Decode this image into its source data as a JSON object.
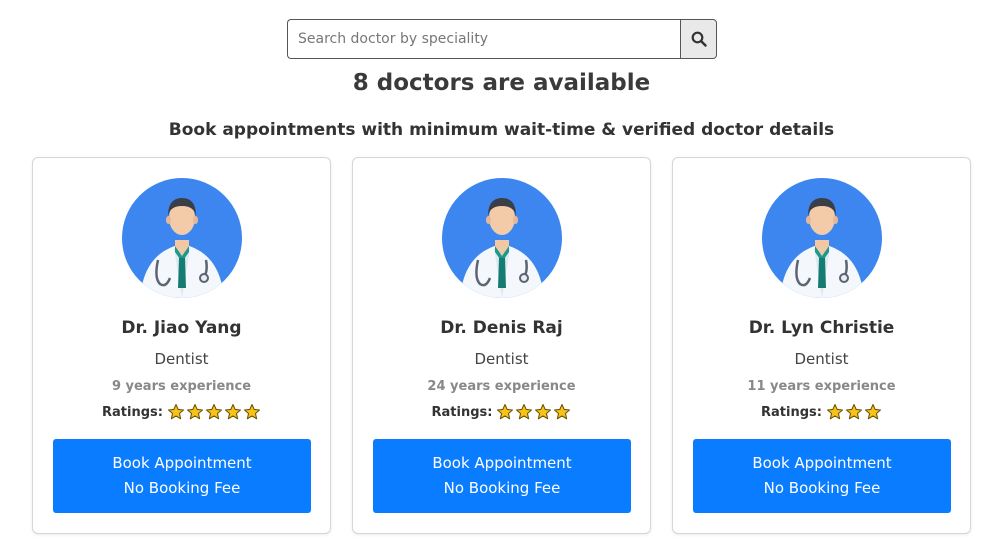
{
  "search": {
    "placeholder": "Search doctor by speciality",
    "value": "",
    "button_icon": "search-icon"
  },
  "heading": "8 doctors are available",
  "subheading": "Book appointments with minimum wait-time & verified doctor details",
  "ratings_label": "Ratings:",
  "colors": {
    "primary_button": "#0a7cff",
    "avatar_background": "#3d86f0",
    "star": "#f7c21c"
  },
  "doctors": [
    {
      "name": "Dr. Jiao Yang",
      "speciality": "Dentist",
      "experience": "9 years experience",
      "rating": 5,
      "avatar_icon": "doctor-avatar-icon",
      "button_line1": "Book Appointment",
      "button_line2": "No Booking Fee"
    },
    {
      "name": "Dr. Denis Raj",
      "speciality": "Dentist",
      "experience": "24 years experience",
      "rating": 4,
      "avatar_icon": "doctor-avatar-icon",
      "button_line1": "Book Appointment",
      "button_line2": "No Booking Fee"
    },
    {
      "name": "Dr. Lyn Christie",
      "speciality": "Dentist",
      "experience": "11 years experience",
      "rating": 3,
      "avatar_icon": "doctor-avatar-icon",
      "button_line1": "Book Appointment",
      "button_line2": "No Booking Fee"
    }
  ]
}
